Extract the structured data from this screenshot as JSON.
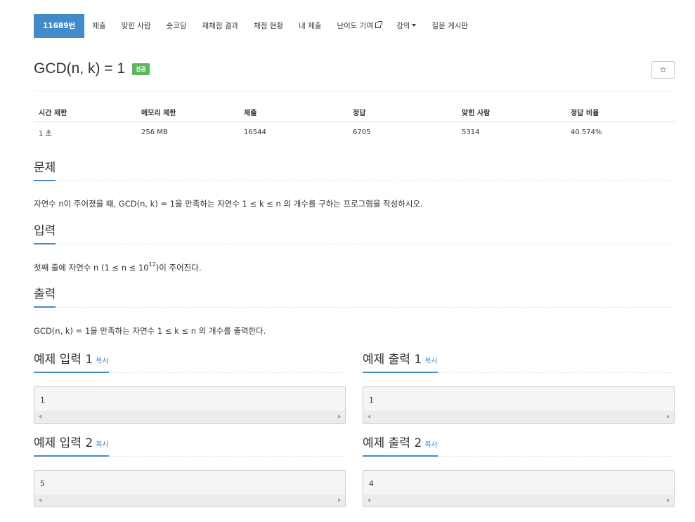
{
  "nav": {
    "problem_id": "11689번",
    "items": [
      "제출",
      "맞힌 사람",
      "숏코딩",
      "재채점 결과",
      "채점 현황",
      "내 제출",
      "난이도 기여",
      "강의",
      "질문 게시판"
    ]
  },
  "problem": {
    "title": "GCD(n, k) = 1",
    "status_badge": "성공",
    "star": "☆"
  },
  "info_table": {
    "headers": [
      "시간 제한",
      "메모리 제한",
      "제출",
      "정답",
      "맞힌 사람",
      "정답 비율"
    ],
    "values": [
      "1 초",
      "256 MB",
      "16544",
      "6705",
      "5314",
      "40.574%"
    ]
  },
  "sections": {
    "description": {
      "title": "문제",
      "text": "자연수 n이 주어졌을 때, GCD(n, k) = 1을 만족하는 자연수 1 ≤ k ≤ n 의 개수를 구하는 프로그램을 작성하시오."
    },
    "input": {
      "title": "입력",
      "text_before": "첫째 줄에 자연수 n (1 ≤ n ≤ 10",
      "exponent": "12",
      "text_after": ")이 주어진다."
    },
    "output": {
      "title": "출력",
      "text": "GCD(n, k) = 1을 만족하는 자연수 1 ≤ k ≤ n 의 개수를 출력한다."
    }
  },
  "samples": {
    "copy_label": "복사",
    "input1": {
      "title": "예제 입력 1",
      "value": "1"
    },
    "output1": {
      "title": "예제 출력 1",
      "value": "1"
    },
    "input2": {
      "title": "예제 입력 2",
      "value": "5"
    },
    "output2": {
      "title": "예제 출력 2",
      "value": "4"
    }
  },
  "colors": {
    "primary": "#428bca",
    "success": "#5cb85c"
  }
}
